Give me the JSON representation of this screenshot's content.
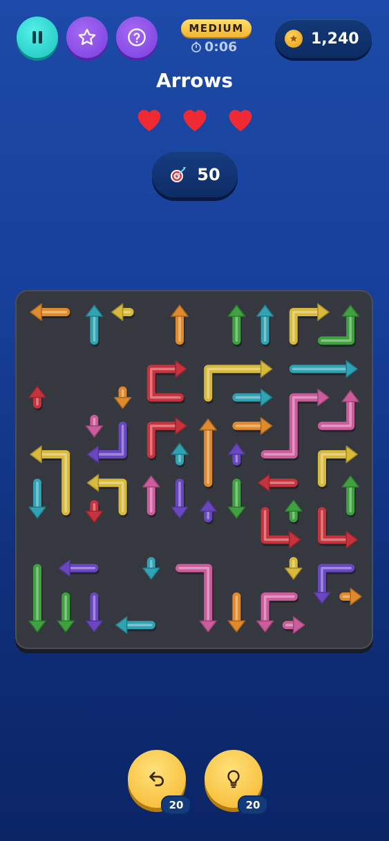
{
  "header": {
    "difficulty": "MEDIUM",
    "timer": "0:06",
    "coins": "1,240"
  },
  "title": "Arrows",
  "lives": {
    "total": 3,
    "remaining": 3
  },
  "target": {
    "value": "50",
    "icon": "dart-target-icon"
  },
  "actions": {
    "undo_count": "20",
    "hint_count": "20"
  },
  "colors": {
    "orange": "#e08a2c",
    "teal": "#2fa3b3",
    "yellow": "#d8b93a",
    "green": "#3ea33f",
    "red": "#c8323c",
    "pink": "#cc5c9c",
    "purple": "#6a47c2"
  },
  "board": {
    "grid_size": 12,
    "arrows": [
      {
        "color": "orange",
        "path": [
          [
            1,
            0
          ],
          [
            0,
            0
          ]
        ]
      },
      {
        "color": "teal",
        "path": [
          [
            2,
            1
          ],
          [
            2,
            0
          ]
        ]
      },
      {
        "color": "yellow",
        "path": [
          [
            3,
            0
          ],
          [
            3,
            0
          ]
        ],
        "dir": "left"
      },
      {
        "color": "orange",
        "path": [
          [
            5,
            1
          ],
          [
            5,
            0
          ]
        ]
      },
      {
        "color": "green",
        "path": [
          [
            7,
            1
          ],
          [
            7,
            0
          ]
        ]
      },
      {
        "color": "teal",
        "path": [
          [
            8,
            1
          ],
          [
            8,
            0
          ]
        ]
      },
      {
        "color": "yellow",
        "path": [
          [
            9,
            1
          ],
          [
            9,
            0
          ],
          [
            10,
            0
          ]
        ]
      },
      {
        "color": "green",
        "path": [
          [
            10,
            1
          ],
          [
            11,
            1
          ],
          [
            11,
            0
          ]
        ]
      },
      {
        "color": "red",
        "path": [
          [
            5,
            3
          ],
          [
            4,
            3
          ],
          [
            4,
            2
          ],
          [
            5,
            2
          ]
        ]
      },
      {
        "color": "yellow",
        "path": [
          [
            6,
            3
          ],
          [
            6,
            2
          ],
          [
            8,
            2
          ]
        ]
      },
      {
        "color": "teal",
        "path": [
          [
            9,
            2
          ],
          [
            11,
            2
          ]
        ]
      },
      {
        "color": "red",
        "path": [
          [
            0,
            3
          ],
          [
            0,
            3
          ]
        ],
        "dir": "up"
      },
      {
        "color": "orange",
        "path": [
          [
            3,
            3
          ],
          [
            3,
            3
          ]
        ],
        "dir": "down"
      },
      {
        "color": "teal",
        "path": [
          [
            7,
            3
          ],
          [
            8,
            3
          ]
        ]
      },
      {
        "color": "pink",
        "path": [
          [
            8,
            5
          ],
          [
            9,
            5
          ],
          [
            9,
            3
          ],
          [
            10,
            3
          ]
        ]
      },
      {
        "color": "pink",
        "path": [
          [
            10,
            4
          ],
          [
            11,
            4
          ],
          [
            11,
            3
          ]
        ]
      },
      {
        "color": "pink",
        "path": [
          [
            2,
            4
          ],
          [
            2,
            4
          ]
        ],
        "dir": "down"
      },
      {
        "color": "purple",
        "path": [
          [
            3,
            4
          ],
          [
            3,
            5
          ],
          [
            2,
            5
          ]
        ]
      },
      {
        "color": "red",
        "path": [
          [
            4,
            5
          ],
          [
            4,
            4
          ],
          [
            5,
            4
          ]
        ]
      },
      {
        "color": "orange",
        "path": [
          [
            6,
            6
          ],
          [
            6,
            4
          ]
        ]
      },
      {
        "color": "orange",
        "path": [
          [
            7,
            4
          ],
          [
            8,
            4
          ]
        ]
      },
      {
        "color": "yellow",
        "path": [
          [
            1,
            7
          ],
          [
            1,
            5
          ],
          [
            0,
            5
          ]
        ]
      },
      {
        "color": "teal",
        "path": [
          [
            5,
            5
          ],
          [
            5,
            5
          ]
        ],
        "dir": "up"
      },
      {
        "color": "purple",
        "path": [
          [
            7,
            5
          ],
          [
            7,
            5
          ]
        ],
        "dir": "up"
      },
      {
        "color": "yellow",
        "path": [
          [
            10,
            6
          ],
          [
            10,
            5
          ],
          [
            11,
            5
          ]
        ]
      },
      {
        "color": "teal",
        "path": [
          [
            0,
            6
          ],
          [
            0,
            7
          ]
        ]
      },
      {
        "color": "yellow",
        "path": [
          [
            3,
            7
          ],
          [
            3,
            6
          ],
          [
            2,
            6
          ]
        ]
      },
      {
        "color": "pink",
        "path": [
          [
            4,
            7
          ],
          [
            4,
            6
          ]
        ]
      },
      {
        "color": "purple",
        "path": [
          [
            5,
            6
          ],
          [
            5,
            7
          ]
        ]
      },
      {
        "color": "green",
        "path": [
          [
            7,
            6
          ],
          [
            7,
            7
          ]
        ]
      },
      {
        "color": "red",
        "path": [
          [
            9,
            6
          ],
          [
            8,
            6
          ]
        ]
      },
      {
        "color": "green",
        "path": [
          [
            11,
            7
          ],
          [
            11,
            6
          ]
        ]
      },
      {
        "color": "red",
        "path": [
          [
            2,
            7
          ],
          [
            2,
            7
          ]
        ],
        "dir": "down"
      },
      {
        "color": "purple",
        "path": [
          [
            6,
            7
          ],
          [
            6,
            7
          ]
        ],
        "dir": "up"
      },
      {
        "color": "green",
        "path": [
          [
            9,
            7
          ],
          [
            9,
            7
          ]
        ],
        "dir": "up"
      },
      {
        "color": "red",
        "path": [
          [
            8,
            7
          ],
          [
            8,
            8
          ],
          [
            9,
            8
          ]
        ]
      },
      {
        "color": "red",
        "path": [
          [
            10,
            7
          ],
          [
            10,
            8
          ],
          [
            11,
            8
          ]
        ]
      },
      {
        "color": "purple",
        "path": [
          [
            2,
            9
          ],
          [
            1,
            9
          ]
        ]
      },
      {
        "color": "teal",
        "path": [
          [
            4,
            9
          ],
          [
            4,
            9
          ]
        ],
        "dir": "down"
      },
      {
        "color": "yellow",
        "path": [
          [
            9,
            9
          ],
          [
            9,
            9
          ]
        ],
        "dir": "down"
      },
      {
        "color": "purple",
        "path": [
          [
            11,
            9
          ],
          [
            10,
            9
          ],
          [
            10,
            10
          ]
        ]
      },
      {
        "color": "green",
        "path": [
          [
            0,
            9
          ],
          [
            0,
            11
          ]
        ]
      },
      {
        "color": "pink",
        "path": [
          [
            5,
            9
          ],
          [
            6,
            9
          ],
          [
            6,
            11
          ]
        ]
      },
      {
        "color": "orange",
        "path": [
          [
            11,
            10
          ],
          [
            11,
            10
          ]
        ],
        "dir": "right"
      },
      {
        "color": "green",
        "path": [
          [
            1,
            10
          ],
          [
            1,
            11
          ]
        ]
      },
      {
        "color": "purple",
        "path": [
          [
            2,
            10
          ],
          [
            2,
            11
          ]
        ]
      },
      {
        "color": "orange",
        "path": [
          [
            7,
            10
          ],
          [
            7,
            11
          ]
        ]
      },
      {
        "color": "pink",
        "path": [
          [
            9,
            10
          ],
          [
            8,
            10
          ],
          [
            8,
            11
          ]
        ]
      },
      {
        "color": "teal",
        "path": [
          [
            4,
            11
          ],
          [
            3,
            11
          ]
        ]
      },
      {
        "color": "pink",
        "path": [
          [
            9,
            11
          ],
          [
            9,
            11
          ]
        ],
        "dir": "right"
      }
    ]
  }
}
